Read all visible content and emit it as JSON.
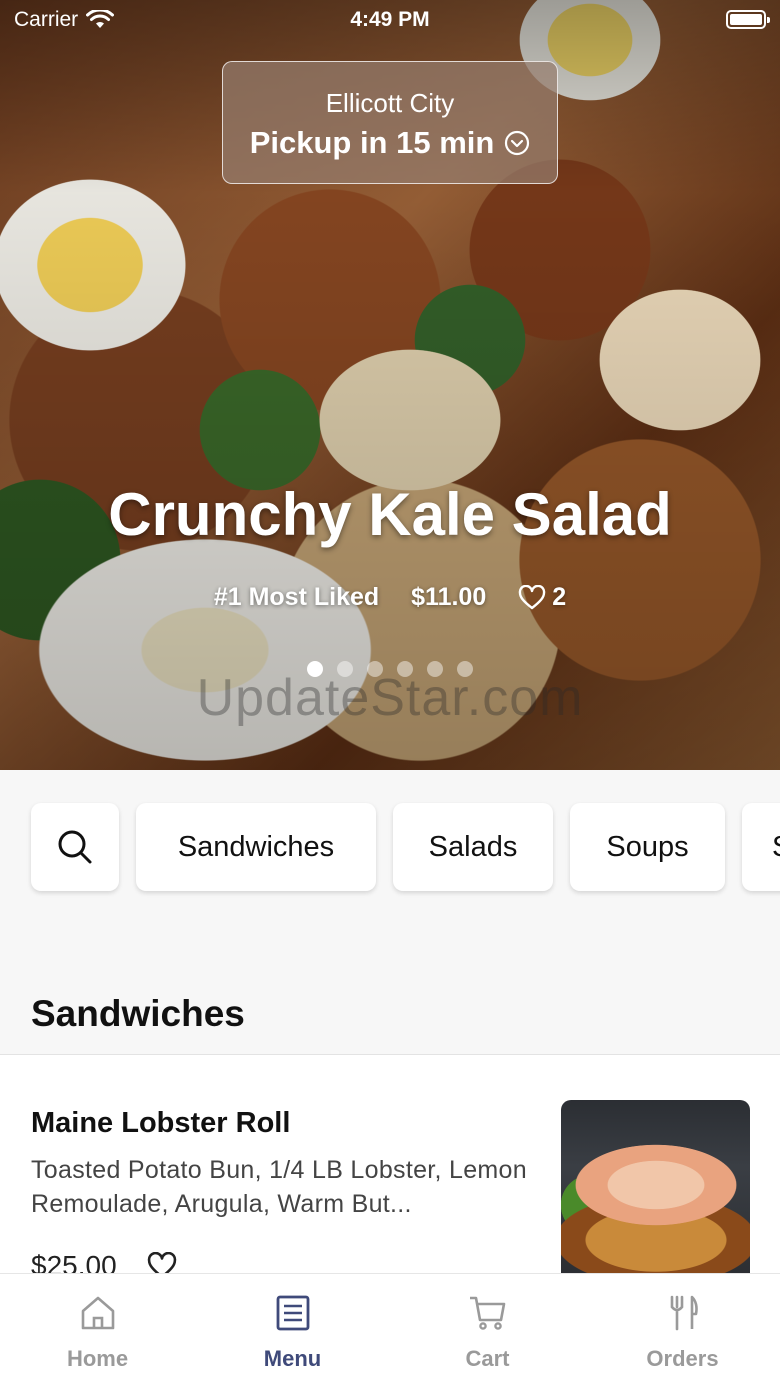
{
  "status_bar": {
    "carrier": "Carrier",
    "time": "4:49 PM"
  },
  "location": {
    "city": "Ellicott City",
    "pickup": "Pickup in 15 min"
  },
  "hero": {
    "title": "Crunchy Kale Salad",
    "rank": "#1 Most Liked",
    "price": "$11.00",
    "likes": "2",
    "carousel": {
      "total": 6,
      "active": 1
    },
    "watermark": "UpdateStar.com"
  },
  "categories": [
    "Sandwiches",
    "Salads",
    "Soups",
    "S"
  ],
  "section": {
    "title": "Sandwiches",
    "items": [
      {
        "name": "Maine Lobster Roll",
        "description": "Toasted Potato Bun, 1/4 LB Lobster, Lemon Remoulade, Arugula, Warm But...",
        "price": "$25.00"
      }
    ]
  },
  "tabs": [
    {
      "label": "Home",
      "icon": "home-icon",
      "active": false
    },
    {
      "label": "Menu",
      "icon": "menu-list-icon",
      "active": true
    },
    {
      "label": "Cart",
      "icon": "cart-icon",
      "active": false
    },
    {
      "label": "Orders",
      "icon": "fork-knife-icon",
      "active": false
    }
  ],
  "colors": {
    "accent": "#3f4a7a",
    "inactive": "#9a9a9a"
  }
}
